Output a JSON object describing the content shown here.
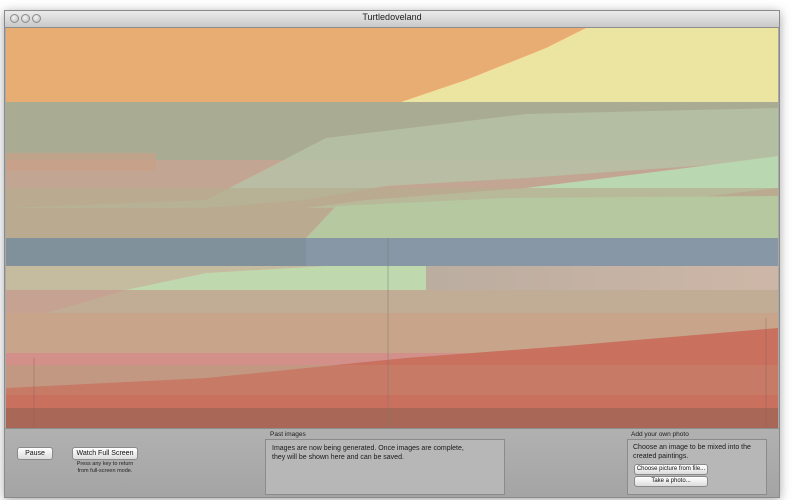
{
  "window": {
    "title": "Turtledoveland"
  },
  "controls": {
    "pause_label": "Pause",
    "fullscreen_label": "Watch Full Screen",
    "fullscreen_hint_line1": "Press any key to return",
    "fullscreen_hint_line2": "from full-screen mode."
  },
  "past_images": {
    "label": "Past images",
    "message_line1": "Images are now being generated. Once images are complete,",
    "message_line2": "they will be shown here and can be saved."
  },
  "add_photo": {
    "label": "Add your own photo",
    "description_line1": "Choose an image to be mixed into the",
    "description_line2": "created paintings.",
    "choose_file_label": "Choose picture from file...",
    "take_photo_label": "Take a photo..."
  },
  "palette": {
    "orange": "#e8ad73",
    "yellow": "#ece5a2",
    "gray_green": "#a9ab93",
    "mint": "#b9d7b0",
    "blue": "#8797a6",
    "pink": "#d38f8a",
    "red": "#c9705f"
  }
}
